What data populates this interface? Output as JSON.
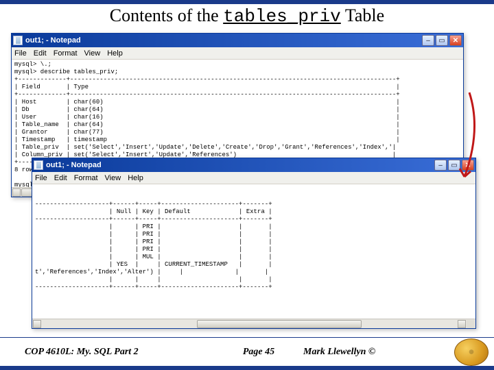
{
  "slide": {
    "title_prefix": "Contents of the ",
    "title_code": "tables_priv",
    "title_suffix": " Table"
  },
  "menu": {
    "file": "File",
    "edit": "Edit",
    "format": "Format",
    "view": "View",
    "help": "Help"
  },
  "window1": {
    "title": "out1; - Notepad",
    "content": "mysql> \\.;\nmysql> describe tables_priv;\n+-------------+----------------------------------------------------------------------------------------+\n| Field       | Type                                                                                   |\n+-------------+----------------------------------------------------------------------------------------+\n| Host        | char(60)                                                                               |\n| Db          | char(64)                                                                               |\n| User        | char(16)                                                                               |\n| Table_name  | char(64)                                                                               |\n| Grantor     | char(77)                                                                               |\n| Timestamp   | timestamp                                                                              |\n| Table_priv  | set('Select','Insert','Update','Delete','Create','Drop','Grant','References','Index','|\n| Column_priv | set('Select','Insert','Update','References')                                          |\n+-------------+----------------------------------------------------------------------------------------+\n8 rows in set (0.00 sec)\n\nmysql>"
  },
  "window2": {
    "title": "out1; - Notepad",
    "content": "\n\n--------------------+------+-----+---------------------+-------+\n                    | Null | Key | Default             | Extra |\n--------------------+------+-----+---------------------+-------+\n                    |      | PRI |                     |       |\n                    |      | PRI |                     |       |\n                    |      | PRI |                     |       |\n                    |      | PRI |                     |       |\n                    |      | MUL |                     |       |\n                    | YES  |     | CURRENT_TIMESTAMP   |       |\nt','References','Index','Alter') |     |              |       |\n                    |      |     |                     |       |\n--------------------+------+-----+---------------------+-------+\n"
  },
  "footer": {
    "course": "COP 4610L: My. SQL Part 2",
    "page": "Page 45",
    "author": "Mark Llewellyn ©"
  },
  "icons": {
    "min": "–",
    "max": "▭",
    "close": "✕"
  }
}
